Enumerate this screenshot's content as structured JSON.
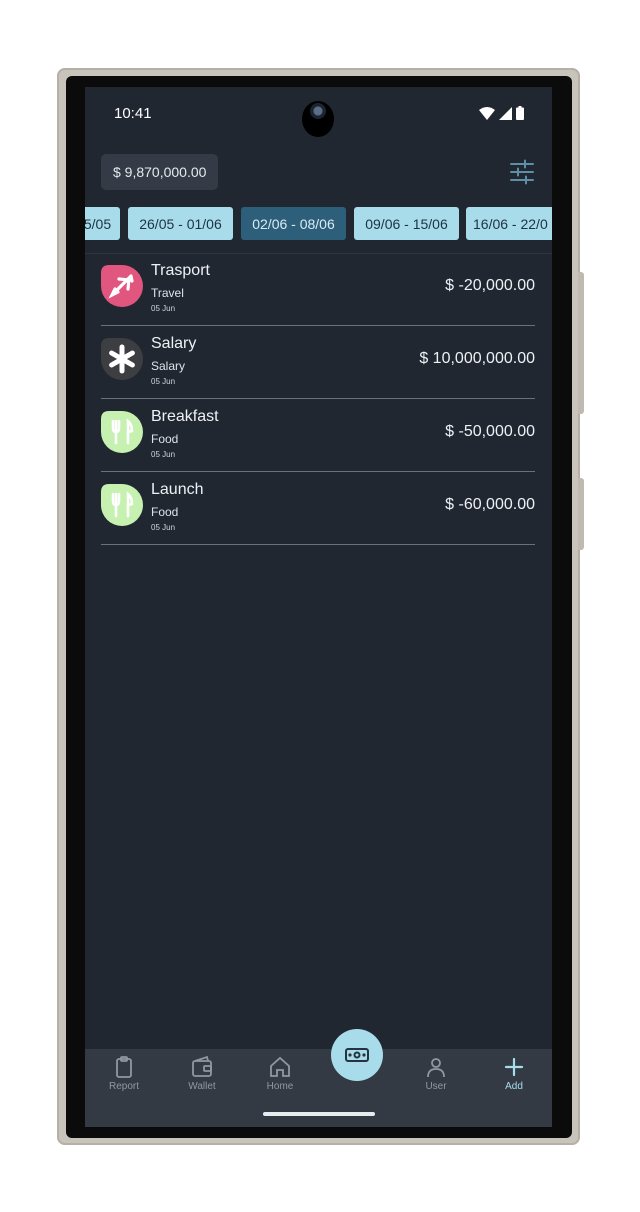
{
  "status": {
    "time": "10:41"
  },
  "header": {
    "balance": "$ 9,870,000.00"
  },
  "weeks": [
    {
      "label": "5/05",
      "active": false
    },
    {
      "label": "26/05 - 01/06",
      "active": false
    },
    {
      "label": "02/06 - 08/06",
      "active": true
    },
    {
      "label": "09/06 - 15/06",
      "active": false
    },
    {
      "label": "16/06 - 22/0",
      "active": false
    }
  ],
  "transactions": [
    {
      "title": "Trasport",
      "category": "Travel",
      "date": "05 Jun",
      "amount": "$ -20,000.00",
      "icon": "airplane-icon",
      "color": "#e0567f"
    },
    {
      "title": "Salary",
      "category": "Salary",
      "date": "05 Jun",
      "amount": "$ 10,000,000.00",
      "icon": "asterisk-icon",
      "color": "#3d3e42"
    },
    {
      "title": "Breakfast",
      "category": "Food",
      "date": "05 Jun",
      "amount": "$ -50,000.00",
      "icon": "fork-knife-icon",
      "color": "#c6f1b0"
    },
    {
      "title": "Launch",
      "category": "Food",
      "date": "05 Jun",
      "amount": "$ -60,000.00",
      "icon": "fork-knife-icon",
      "color": "#c6f1b0"
    }
  ],
  "nav": {
    "report": "Report",
    "wallet": "Wallet",
    "home": "Home",
    "user": "User",
    "add": "Add"
  },
  "colors": {
    "accent": "#a8dceb",
    "active_chip": "#2d5f7a",
    "background": "#212731"
  }
}
